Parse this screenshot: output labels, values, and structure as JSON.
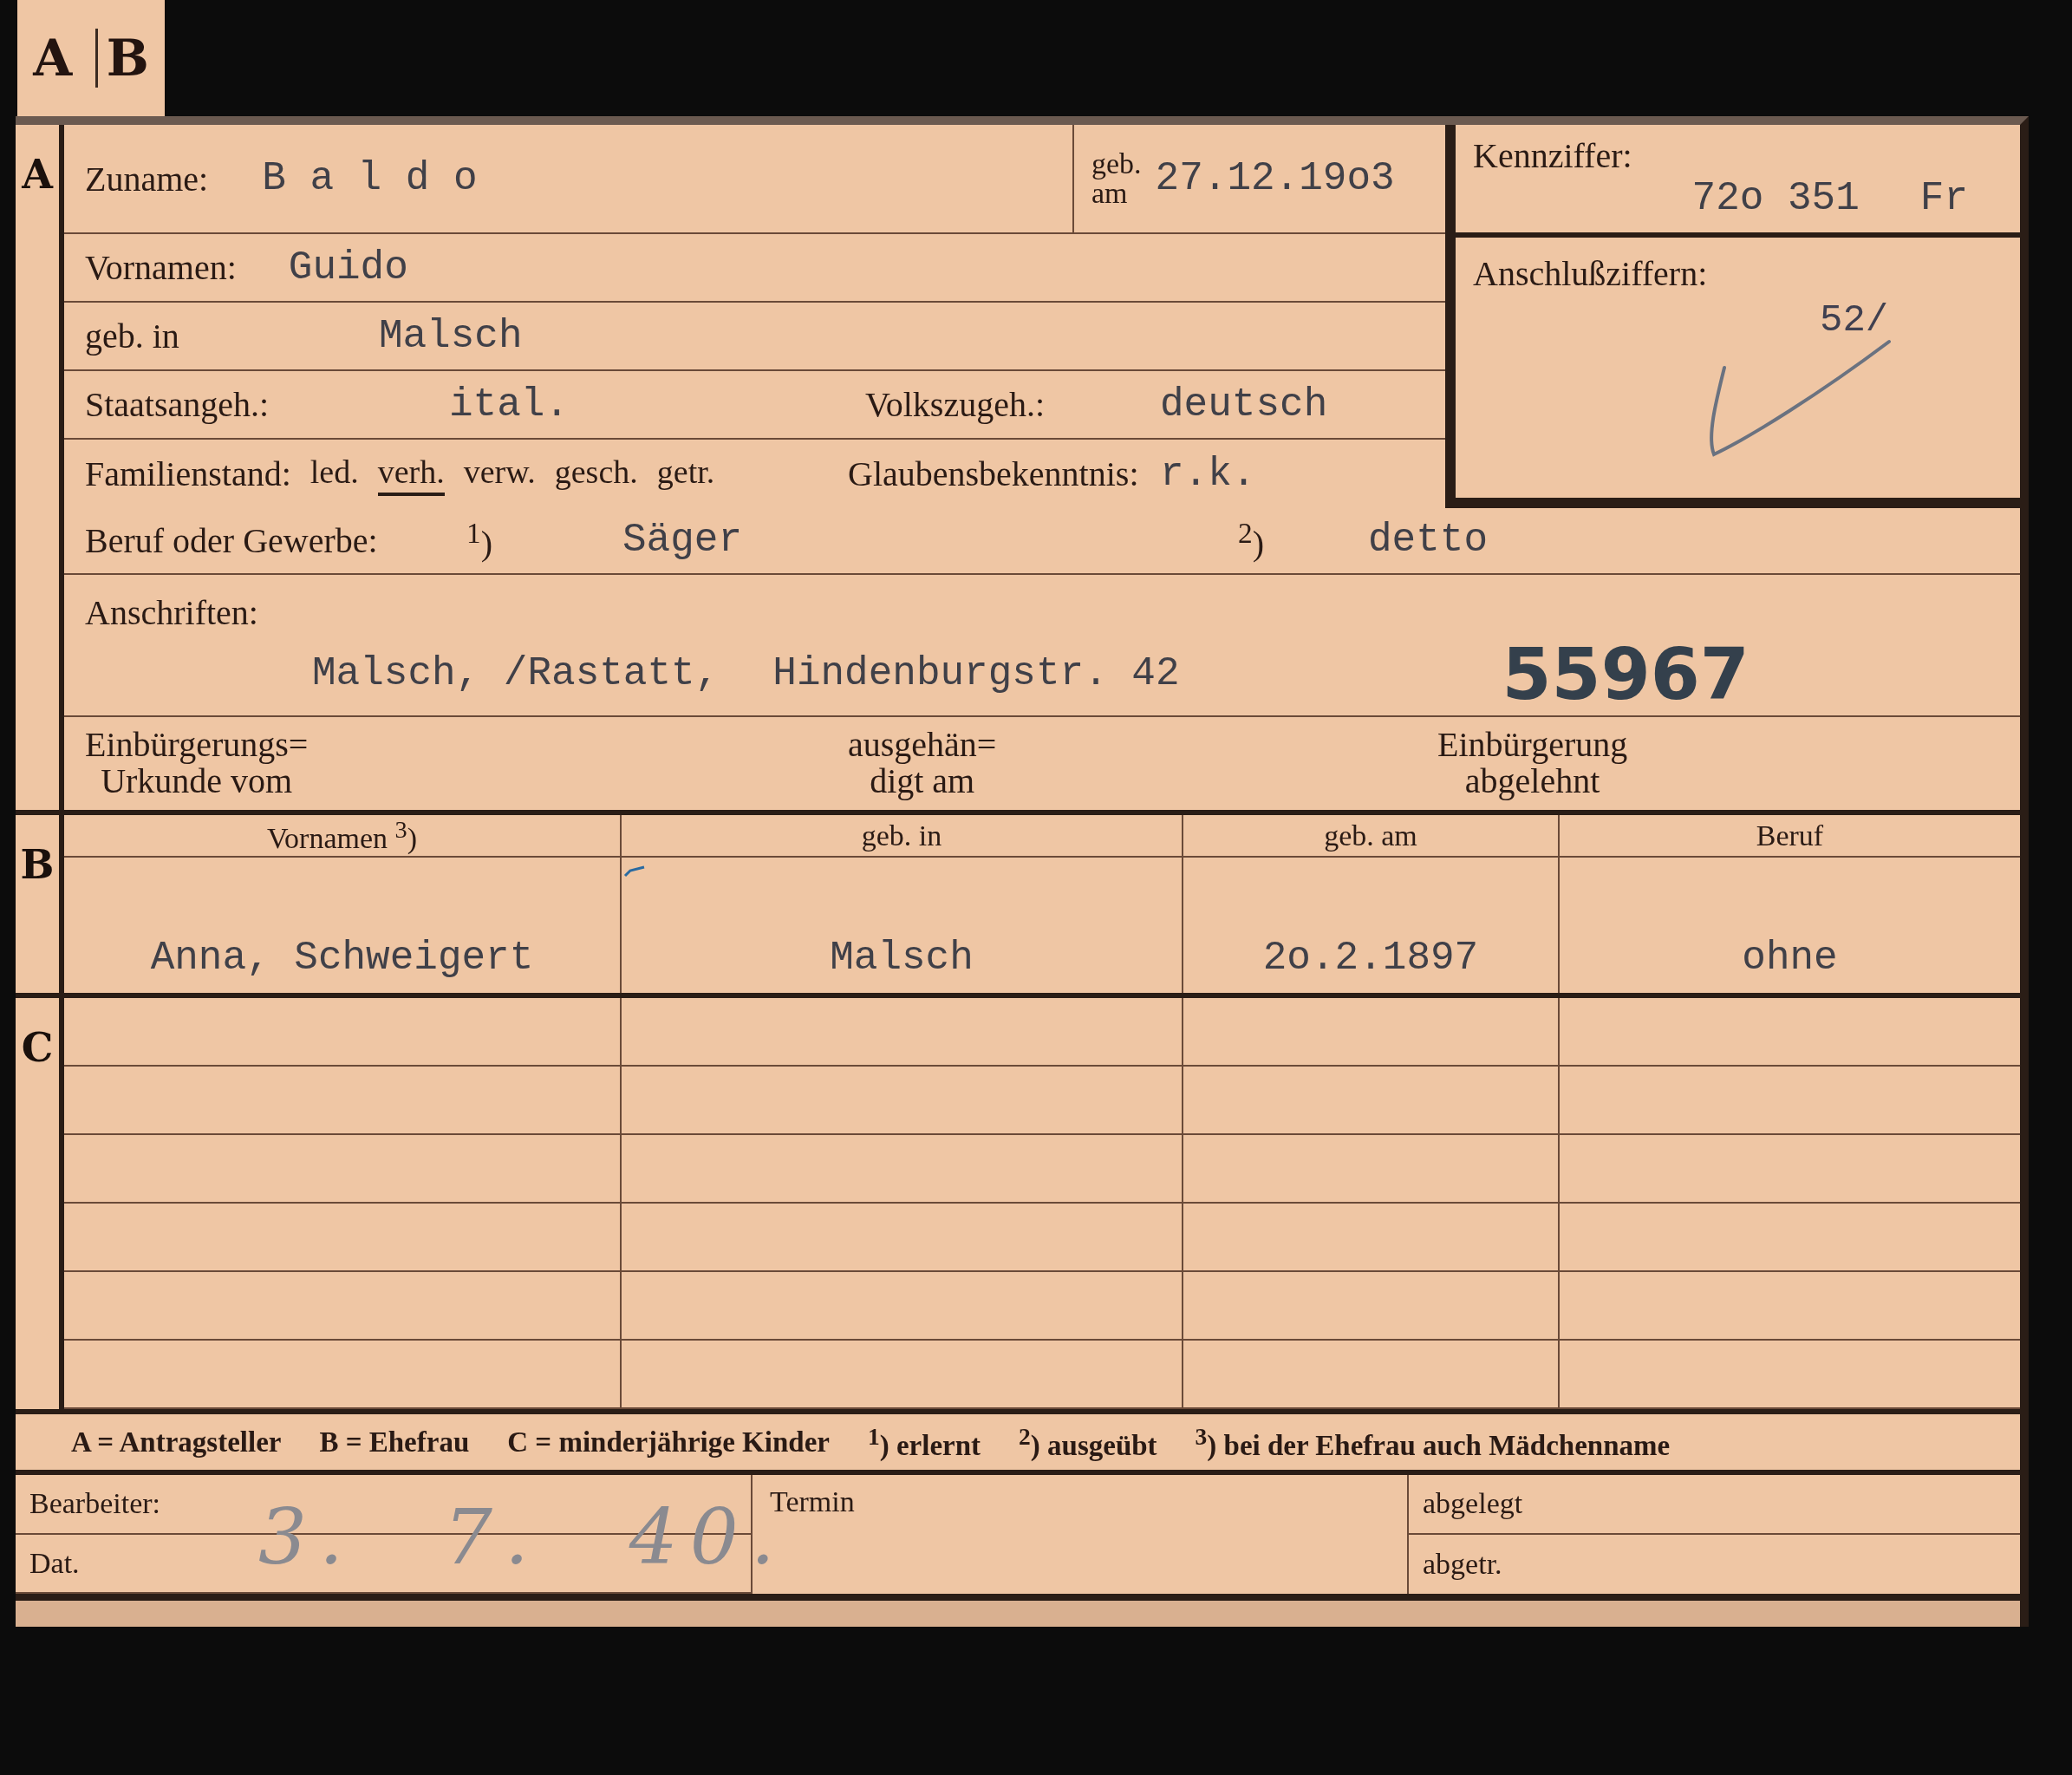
{
  "tab_letters": [
    "A",
    "B"
  ],
  "applicant": {
    "section_letter": "A",
    "surname": {
      "label": "Zuname:",
      "value": "B a l d o"
    },
    "birth_date": {
      "label_lines": [
        "geb.",
        "am"
      ],
      "value": "27.12.19o3"
    },
    "first_names": {
      "label": "Vornamen:",
      "value": "Guido"
    },
    "birthplace": {
      "label": "geb. in",
      "value": "Malsch"
    },
    "citizenship": {
      "label": "Staatsangeh.:",
      "value": "ital."
    },
    "ethnicity": {
      "label": "Volkszugeh.:",
      "value": "deutsch"
    },
    "marital_status": {
      "label": "Familienstand:",
      "options": [
        {
          "label": "led.",
          "selected": false
        },
        {
          "label": "verh.",
          "selected": true
        },
        {
          "label": "verw.",
          "selected": false
        },
        {
          "label": "gesch.",
          "selected": false
        },
        {
          "label": "getr.",
          "selected": false
        }
      ]
    },
    "religion": {
      "label": "Glaubensbekenntnis:",
      "value": "r.k."
    },
    "reference_number": {
      "label": "Kennziffer:",
      "value": "72o 351",
      "suffix": "Fr"
    },
    "connection_numbers": {
      "label": "Anschlußziffern:",
      "value": "52/"
    },
    "occupation": {
      "label": "Beruf oder Gewerbe:",
      "note_1": "$^{1}$)",
      "value_1": "Säger",
      "note_2": "$^{2}$)",
      "value_2": "detto"
    },
    "addresses": {
      "label": "Anschriften:",
      "values": [
        "Malsch, /Rastatt,",
        "Hindenburgstr. 42"
      ],
      "stamp": "55967"
    },
    "naturalization": [
      {
        "lines": [
          "Einbürgerungs=",
          "Urkunde vom"
        ]
      },
      {
        "lines": [
          "ausgehän=",
          "digt am"
        ]
      },
      {
        "lines": [
          "Einbürgerung",
          "abgelehnt"
        ]
      }
    ]
  },
  "wife": {
    "section_letter": "B",
    "columns": [
      "Vornamen $^{3}$)",
      "geb. in",
      "geb. am",
      "Beruf"
    ],
    "values": [
      "Anna, Schweigert",
      "Malsch",
      "2o.2.1897",
      "ohne"
    ]
  },
  "children": {
    "section_letter": "C"
  },
  "legend": [
    "A = Antragsteller",
    "B = Ehefrau",
    "C = minderjährige Kinder",
    "$^{1}$) erlernt",
    "$^{2}$) ausgeübt",
    "$^{3}$) bei der Ehefrau auch Mädchenname"
  ],
  "footer": {
    "clerk_label": "Bearbeiter:",
    "date_label": "Dat.",
    "date_value": "3. 7. 40.",
    "deadline_label": "Termin",
    "filed_label": "abgelegt",
    "separated_label": "abgetr."
  }
}
